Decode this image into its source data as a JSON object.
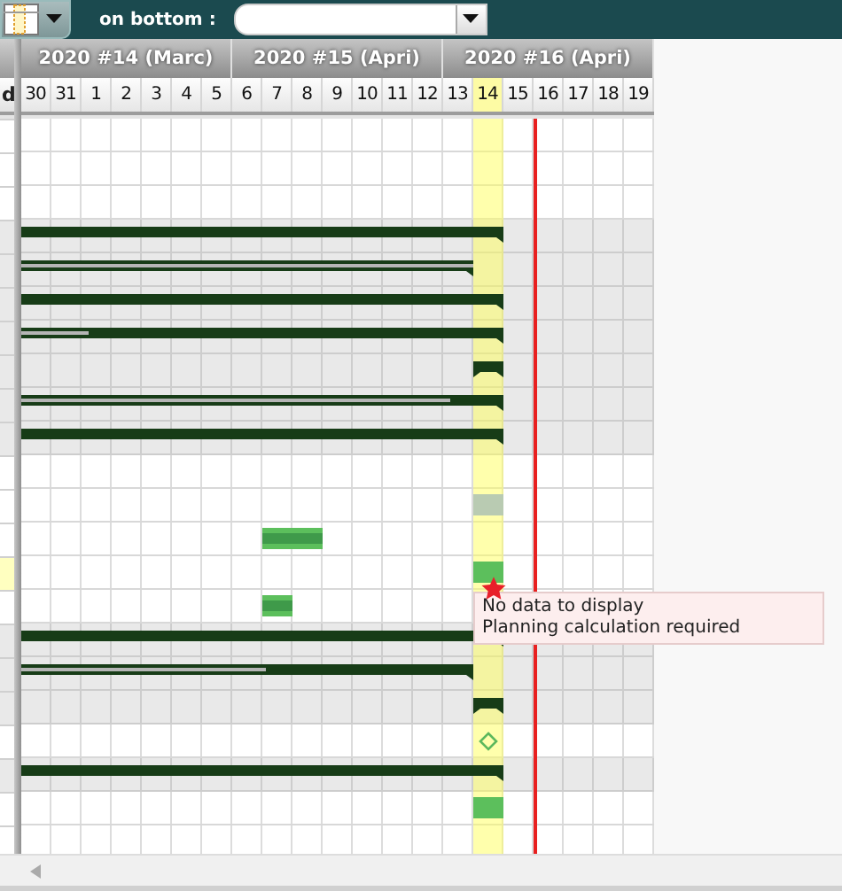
{
  "toolbar": {
    "label": "on bottom :"
  },
  "left_panel": {
    "header": "d"
  },
  "timeline": {
    "weeks": [
      {
        "label": "2020 #14 (Marc)"
      },
      {
        "label": "2020 #15 (Apri)"
      },
      {
        "label": "2020 #16 (Apri)"
      }
    ],
    "days": [
      {
        "label": "30",
        "selected": false
      },
      {
        "label": "31",
        "selected": false
      },
      {
        "label": "1",
        "selected": false
      },
      {
        "label": "2",
        "selected": false
      },
      {
        "label": "3",
        "selected": false
      },
      {
        "label": "4",
        "selected": false
      },
      {
        "label": "5",
        "selected": false
      },
      {
        "label": "6",
        "selected": false
      },
      {
        "label": "7",
        "selected": false
      },
      {
        "label": "8",
        "selected": false
      },
      {
        "label": "9",
        "selected": false
      },
      {
        "label": "10",
        "selected": false
      },
      {
        "label": "11",
        "selected": false
      },
      {
        "label": "12",
        "selected": false
      },
      {
        "label": "13",
        "selected": false
      },
      {
        "label": "14",
        "selected": true
      },
      {
        "label": "15",
        "selected": false
      },
      {
        "label": "16",
        "selected": false
      },
      {
        "label": "17",
        "selected": false
      },
      {
        "label": "18",
        "selected": false
      },
      {
        "label": "19",
        "selected": false
      }
    ]
  },
  "rows": [
    {
      "shaded": false,
      "selected": false,
      "items": []
    },
    {
      "shaded": false,
      "selected": false,
      "items": []
    },
    {
      "shaded": false,
      "selected": false,
      "items": []
    },
    {
      "shaded": true,
      "selected": false,
      "items": [
        {
          "kind": "summary"
        }
      ]
    },
    {
      "shaded": true,
      "selected": false,
      "items": [
        {
          "kind": "summary",
          "level": 1
        }
      ]
    },
    {
      "shaded": true,
      "selected": false,
      "items": [
        {
          "kind": "summary"
        }
      ]
    },
    {
      "shaded": true,
      "selected": false,
      "items": [
        {
          "kind": "summary",
          "level": 0.14
        }
      ]
    },
    {
      "shaded": true,
      "selected": false,
      "items": [
        {
          "kind": "summary"
        }
      ]
    },
    {
      "shaded": true,
      "selected": false,
      "items": [
        {
          "kind": "summary",
          "level": 0.89
        }
      ]
    },
    {
      "shaded": true,
      "selected": false,
      "items": [
        {
          "kind": "summary"
        }
      ]
    },
    {
      "shaded": false,
      "selected": false,
      "items": []
    },
    {
      "shaded": false,
      "selected": false,
      "items": [
        {
          "kind": "pending"
        }
      ]
    },
    {
      "shaded": false,
      "selected": false,
      "items": [
        {
          "kind": "task"
        }
      ]
    },
    {
      "shaded": false,
      "selected": true,
      "items": [
        {
          "kind": "planned"
        }
      ]
    },
    {
      "shaded": false,
      "selected": false,
      "items": [
        {
          "kind": "task"
        },
        {
          "kind": "warning",
          "tooltip": [
            "No data to display",
            "Planning calculation required"
          ]
        }
      ]
    },
    {
      "shaded": true,
      "selected": false,
      "items": [
        {
          "kind": "summary"
        }
      ]
    },
    {
      "shaded": true,
      "selected": false,
      "items": [
        {
          "kind": "summary",
          "level": 0.54
        }
      ]
    },
    {
      "shaded": true,
      "selected": false,
      "items": [
        {
          "kind": "summary"
        }
      ]
    },
    {
      "shaded": false,
      "selected": false,
      "items": [
        {
          "kind": "milestone"
        }
      ]
    },
    {
      "shaded": true,
      "selected": false,
      "items": [
        {
          "kind": "summary"
        }
      ]
    },
    {
      "shaded": false,
      "selected": false,
      "items": [
        {
          "kind": "planned"
        }
      ]
    },
    {
      "shaded": false,
      "selected": false,
      "items": []
    }
  ]
}
